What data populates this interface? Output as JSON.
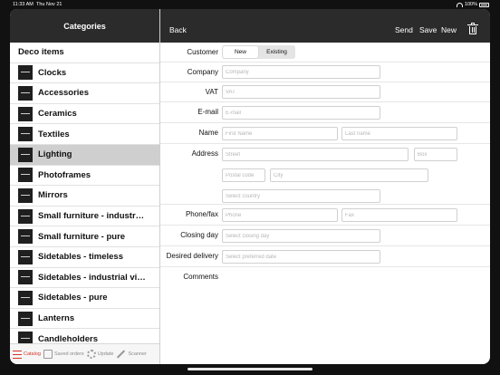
{
  "status_bar": {
    "time": "11:33 AM",
    "date": "Thu Nov 21",
    "battery": "100%"
  },
  "left": {
    "title": "Categories",
    "items": [
      {
        "label": "Deco items",
        "type": "section",
        "selected": false
      },
      {
        "label": "Clocks",
        "selected": false
      },
      {
        "label": "Accessories",
        "selected": false
      },
      {
        "label": "Ceramics",
        "selected": false
      },
      {
        "label": "Textiles",
        "selected": false
      },
      {
        "label": "Lighting",
        "selected": true
      },
      {
        "label": "Photoframes",
        "selected": false
      },
      {
        "label": "Mirrors",
        "selected": false
      },
      {
        "label": "Small furniture - industr…",
        "selected": false
      },
      {
        "label": "Small furniture - pure",
        "selected": false
      },
      {
        "label": "Sidetables - timeless",
        "selected": false
      },
      {
        "label": "Sidetables - industrial vi…",
        "selected": false
      },
      {
        "label": "Sidetables - pure",
        "selected": false
      },
      {
        "label": "Lanterns",
        "selected": false
      },
      {
        "label": "Candleholders",
        "selected": false
      }
    ],
    "tabs": [
      {
        "label": "Catalog",
        "icon": "list-icon",
        "active": true
      },
      {
        "label": "Saved orders",
        "icon": "box-icon",
        "active": false
      },
      {
        "label": "Update",
        "icon": "gear-icon",
        "active": false
      },
      {
        "label": "Scanner",
        "icon": "pen-icon",
        "active": false
      }
    ]
  },
  "right": {
    "header": {
      "back": "Back",
      "send": "Send",
      "save": "Save",
      "new": "New",
      "trash_icon": "trash-icon"
    },
    "form": {
      "customer": {
        "label": "Customer",
        "options": [
          "New",
          "Existing"
        ],
        "selected": "New"
      },
      "company": {
        "label": "Company",
        "placeholder": "Company"
      },
      "vat": {
        "label": "VAT",
        "placeholder": "VAT"
      },
      "email": {
        "label": "E-mail",
        "placeholder": "E-mail"
      },
      "name": {
        "label": "Name",
        "first_placeholder": "First Name",
        "last_placeholder": "Last name"
      },
      "address": {
        "label": "Address",
        "street_placeholder": "Street",
        "box_placeholder": "Box",
        "postal_placeholder": "Postal code",
        "city_placeholder": "City",
        "country_placeholder": "Select country"
      },
      "phone": {
        "label": "Phone/fax",
        "phone_placeholder": "Phone",
        "fax_placeholder": "Fax"
      },
      "closing_day": {
        "label": "Closing day",
        "placeholder": "Select closing day"
      },
      "delivery": {
        "label": "Desired delivery",
        "placeholder": "Select preferred date"
      },
      "comments": {
        "label": "Comments"
      }
    }
  }
}
